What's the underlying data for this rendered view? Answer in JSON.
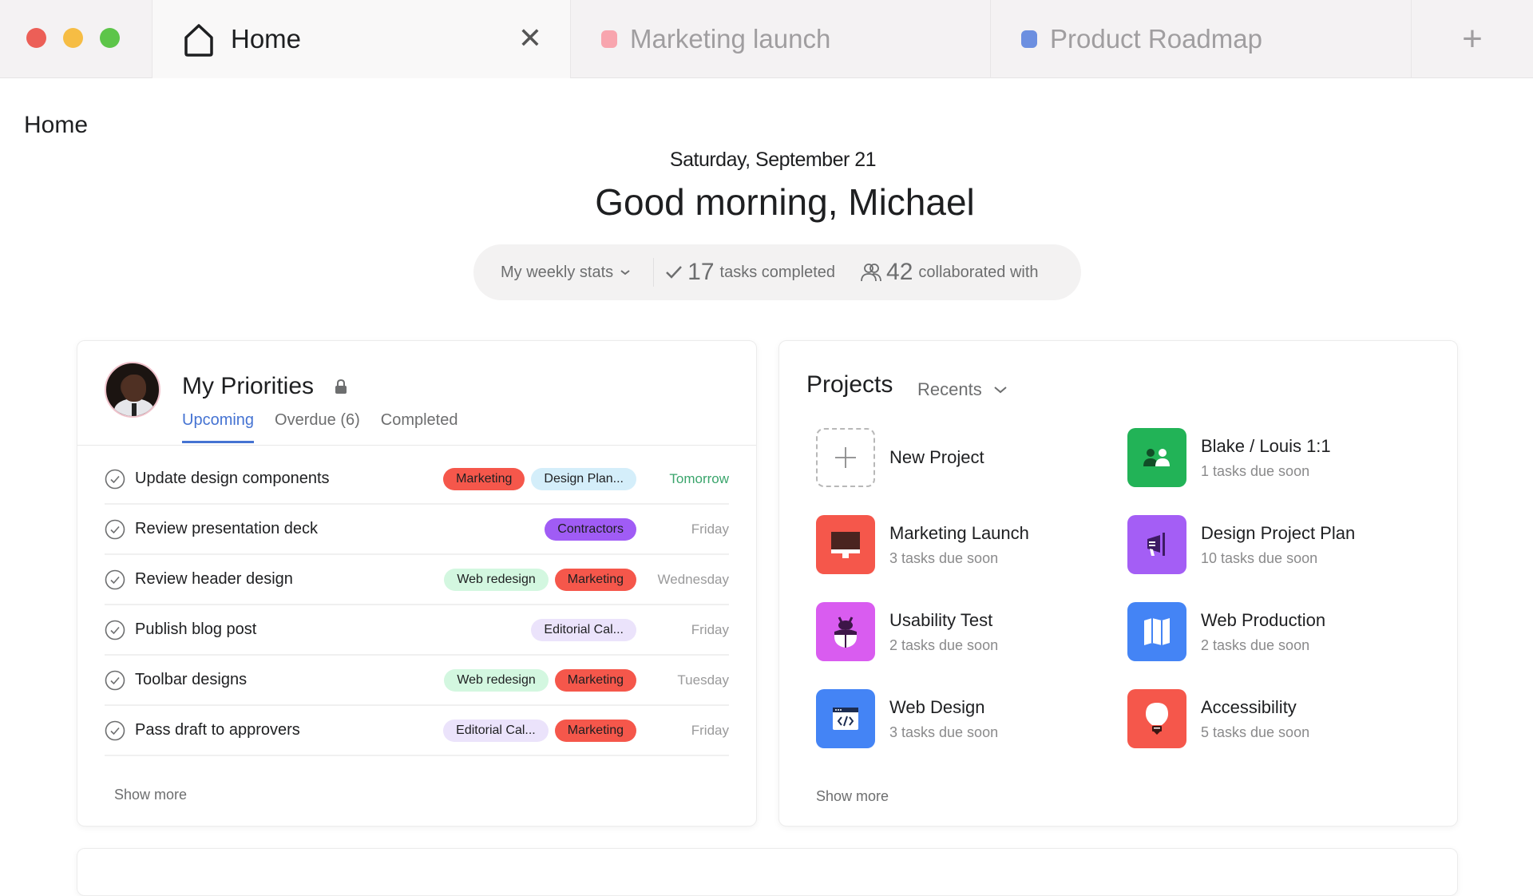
{
  "window": {
    "tabs": [
      {
        "label": "Home",
        "active": true,
        "icon": "home-icon"
      },
      {
        "label": "Marketing launch",
        "active": false,
        "color": "#f8a5ae"
      },
      {
        "label": "Product Roadmap",
        "active": false,
        "color": "#6c8fe0"
      }
    ],
    "new_tab_label": "+",
    "close_label": "✕"
  },
  "header": {
    "page_title": "Home",
    "date": "Saturday, September 21",
    "greeting": "Good morning, Michael"
  },
  "stats": {
    "period_label": "My weekly stats",
    "tasks_completed_count": "17",
    "tasks_completed_label": "tasks completed",
    "collaborated_count": "42",
    "collaborated_label": "collaborated with"
  },
  "priorities": {
    "title": "My Priorities",
    "tabs": [
      "Upcoming",
      "Overdue (6)",
      "Completed"
    ],
    "active_tab": "Upcoming",
    "tasks": [
      {
        "name": "Update design components",
        "tags": [
          {
            "label": "Marketing",
            "color": "#f5574b"
          },
          {
            "label": "Design Plan...",
            "color": "#d4eefa"
          }
        ],
        "due": "Tomorrow",
        "due_soon": true
      },
      {
        "name": "Review presentation deck",
        "tags": [
          {
            "label": "Contractors",
            "color": "#a05cf5"
          }
        ],
        "due": "Friday",
        "due_soon": false
      },
      {
        "name": "Review header design",
        "tags": [
          {
            "label": "Web redesign",
            "color": "#d3f7e0"
          },
          {
            "label": "Marketing",
            "color": "#f5574b"
          }
        ],
        "due": "Wednesday",
        "due_soon": false
      },
      {
        "name": "Publish blog post",
        "tags": [
          {
            "label": "Editorial Cal...",
            "color": "#ebe3fb"
          }
        ],
        "due": "Friday",
        "due_soon": false
      },
      {
        "name": "Toolbar designs",
        "tags": [
          {
            "label": "Web redesign",
            "color": "#d3f7e0"
          },
          {
            "label": "Marketing",
            "color": "#f5574b"
          }
        ],
        "due": "Tuesday",
        "due_soon": false
      },
      {
        "name": "Pass draft to approvers",
        "tags": [
          {
            "label": "Editorial Cal...",
            "color": "#ebe3fb"
          },
          {
            "label": "Marketing",
            "color": "#f5574b"
          }
        ],
        "due": "Friday",
        "due_soon": false
      }
    ],
    "show_more": "Show more"
  },
  "projects": {
    "title": "Projects",
    "filter": "Recents",
    "items": [
      {
        "name": "New Project",
        "sub": "",
        "icon": "plus-icon",
        "color": ""
      },
      {
        "name": "Blake / Louis 1:1",
        "sub": "1 tasks due soon",
        "icon": "people-icon",
        "color": "#22b357"
      },
      {
        "name": "Marketing Launch",
        "sub": "3 tasks due soon",
        "icon": "monitor-icon",
        "color": "#f5574b"
      },
      {
        "name": "Design Project Plan",
        "sub": "10 tasks due soon",
        "icon": "megaphone-icon",
        "color": "#a45ef5"
      },
      {
        "name": "Usability Test",
        "sub": "2 tasks due soon",
        "icon": "bug-icon",
        "color": "#d95cf0"
      },
      {
        "name": "Web Production",
        "sub": "2 tasks due soon",
        "icon": "map-icon",
        "color": "#4484f5"
      },
      {
        "name": "Web Design",
        "sub": "3 tasks due soon",
        "icon": "code-window-icon",
        "color": "#4484f5"
      },
      {
        "name": "Accessibility",
        "sub": "5 tasks due soon",
        "icon": "lightbulb-icon",
        "color": "#f5574b"
      }
    ],
    "show_more": "Show more"
  },
  "colors": {
    "accent": "#4573d2",
    "due_soon": "#3aa56c"
  }
}
